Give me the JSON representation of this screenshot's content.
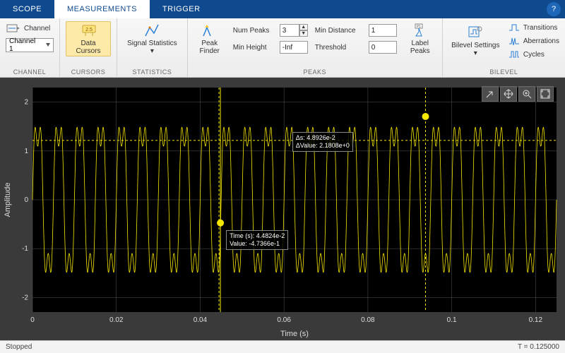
{
  "tabs": {
    "scope": "SCOPE",
    "measurements": "MEASUREMENTS",
    "trigger": "TRIGGER"
  },
  "ribbon": {
    "channel": {
      "label": "Channel",
      "value": "Channel 1",
      "group": "CHANNEL"
    },
    "cursors": {
      "label": "Data\nCursors",
      "group": "CURSORS"
    },
    "statistics": {
      "label": "Signal\nStatistics ▾",
      "group": "STATISTICS"
    },
    "peaks": {
      "finder": "Peak\nFinder",
      "numpeaks_label": "Num Peaks",
      "numpeaks_value": "3",
      "minheight_label": "Min Height",
      "minheight_value": "-Inf",
      "mindist_label": "Min Distance",
      "mindist_value": "1",
      "threshold_label": "Threshold",
      "threshold_value": "0",
      "labelpeaks": "Label\nPeaks",
      "group": "PEAKS"
    },
    "bilevel": {
      "settings": "Bilevel\nSettings ▾",
      "transitions": "Transitions",
      "aberrations": "Aberrations",
      "cycles": "Cycles",
      "group": "BILEVEL"
    }
  },
  "plot": {
    "xlabel": "Time (s)",
    "ylabel": "Amplitude",
    "xticks": [
      "0",
      "0.02",
      "0.04",
      "0.06",
      "0.08",
      "0.1",
      "0.12"
    ],
    "yticks": [
      "-2",
      "-1",
      "0",
      "1",
      "2"
    ]
  },
  "cursor1": {
    "line1": "Time (s): 4.4824e-2",
    "line2": "Value: -4.7366e-1"
  },
  "cursor2": {
    "line1": "Δs: 4.8926e-2",
    "line2": "ΔValue: 2.1808e+0"
  },
  "status": {
    "left": "Stopped",
    "right": "T = 0.125000"
  },
  "chart_data": {
    "type": "line",
    "title": "",
    "xlabel": "Time (s)",
    "ylabel": "Amplitude",
    "xlim": [
      0,
      0.125
    ],
    "ylim": [
      -2.3,
      2.3
    ],
    "description": "Single yellow oscilloscope trace: sum of two sinusoids, roughly 1.6*sin(2π·200·t)+0.5*sin(2π·600·t), sampled densely over 0–0.125 s.",
    "cursors": [
      {
        "x": 0.044824,
        "y": -0.47366
      },
      {
        "x": 0.09375,
        "y": 1.70714
      }
    ],
    "delta": {
      "ds": 0.048926,
      "dvalue": 2.1808
    }
  }
}
